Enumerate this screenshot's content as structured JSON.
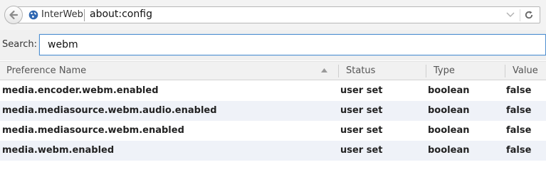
{
  "navbar": {
    "identity_label": "InterWeb",
    "url": "about:config"
  },
  "search": {
    "label": "Search:",
    "value": "webm"
  },
  "table": {
    "columns": [
      "Preference Name",
      "Status",
      "Type",
      "Value"
    ],
    "sorted_column": "Preference Name",
    "rows": [
      {
        "name": "media.encoder.webm.enabled",
        "status": "user set",
        "type": "boolean",
        "value": "false"
      },
      {
        "name": "media.mediasource.webm.audio.enabled",
        "status": "user set",
        "type": "boolean",
        "value": "false"
      },
      {
        "name": "media.mediasource.webm.enabled",
        "status": "user set",
        "type": "boolean",
        "value": "false"
      },
      {
        "name": "media.webm.enabled",
        "status": "user set",
        "type": "boolean",
        "value": "false"
      }
    ]
  },
  "icons": {
    "back": "back-arrow-icon",
    "site": "globe-icon",
    "dropdown": "chevron-down-icon",
    "reload": "reload-icon",
    "sort": "sort-ascending-icon"
  },
  "colors": {
    "focus_border": "#4f8fd0",
    "row_alt_bg": "#eff2f8",
    "globe": "#2f67b1"
  }
}
